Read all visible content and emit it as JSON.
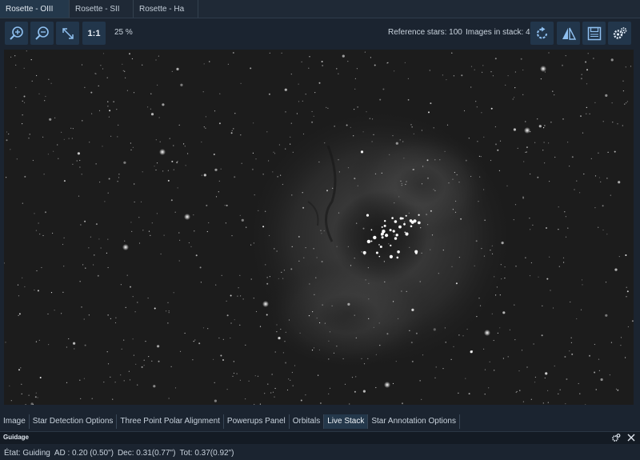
{
  "doc_tabs": [
    {
      "label": "Rosette - OIII",
      "active": true
    },
    {
      "label": "Rosette - SII",
      "active": false
    },
    {
      "label": "Rosette - Ha",
      "active": false
    }
  ],
  "toolbar": {
    "zoom_in_icon": "zoom-in-icon",
    "zoom_out_icon": "zoom-out-icon",
    "fit_icon": "fit-to-window-icon",
    "one_to_one_label": "1:1",
    "zoom_level": "25 %",
    "reference_stars": "Reference stars: 100",
    "images_in_stack": "Images in stack: 4",
    "actions": [
      "rotate-icon",
      "flip-icon",
      "save-icon",
      "settings-icon"
    ]
  },
  "viewer": {
    "content": "Rosette nebula OIII stack"
  },
  "panel_tabs": [
    {
      "label": "Image",
      "active": false
    },
    {
      "label": "Star Detection Options",
      "active": false
    },
    {
      "label": "Three Point Polar Alignment",
      "active": false
    },
    {
      "label": "Powerups Panel",
      "active": false
    },
    {
      "label": "Orbitals",
      "active": false
    },
    {
      "label": "Live Stack",
      "active": true
    },
    {
      "label": "Star Annotation Options",
      "active": false
    }
  ],
  "guidage": {
    "title": "Guidage",
    "state": "État: Guiding",
    "ad": "AD : 0.20 (0.50\")",
    "dec": "Dec: 0.31(0.77\")",
    "tot": "Tot: 0.37(0.92\")"
  },
  "colors": {
    "background": "#1b2430",
    "accent_tab": "#24384b",
    "button": "#22364b",
    "icon": "#7fb0e0"
  }
}
